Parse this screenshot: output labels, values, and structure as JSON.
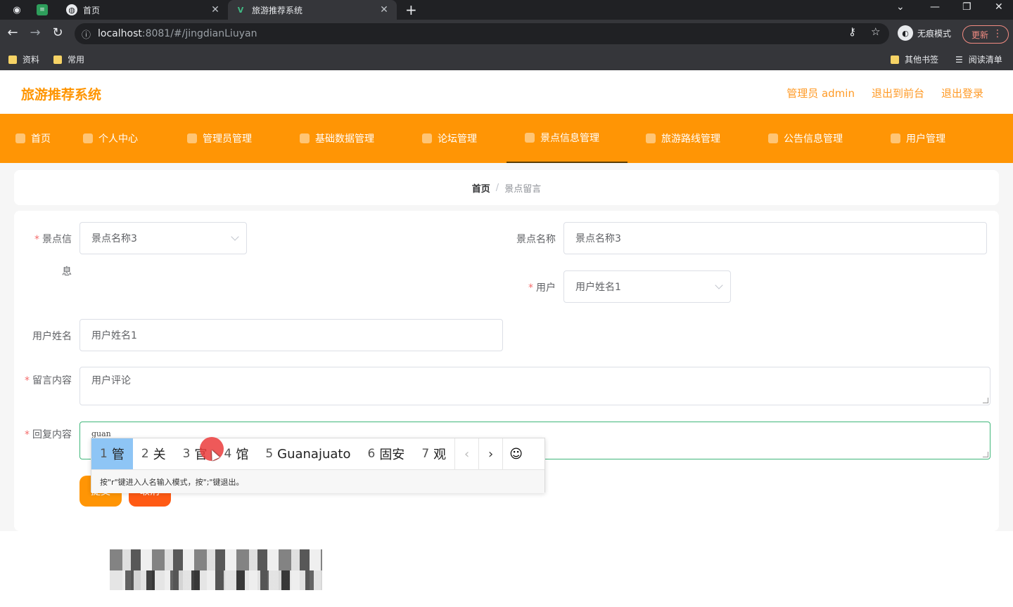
{
  "browser": {
    "tabs": [
      {
        "title": "首页",
        "active": false
      },
      {
        "title": "旅游推荐系统",
        "active": true
      }
    ],
    "url_host": "localhost",
    "url_path": ":8081/#/jingdianLiuyan",
    "incognito_label": "无痕模式",
    "update_label": "更新",
    "bookmarks": [
      "资料",
      "常用"
    ],
    "bookmarks_right": [
      "其他书签",
      "阅读清单"
    ]
  },
  "app": {
    "brand": "旅游推荐系统",
    "header_links": [
      "管理员 admin",
      "退出到前台",
      "退出登录"
    ],
    "nav": [
      {
        "label": "首页"
      },
      {
        "label": "个人中心"
      },
      {
        "label": "管理员管理"
      },
      {
        "label": "基础数据管理"
      },
      {
        "label": "论坛管理"
      },
      {
        "label": "景点信息管理",
        "active": true
      },
      {
        "label": "旅游路线管理"
      },
      {
        "label": "公告信息管理"
      },
      {
        "label": "用户管理"
      }
    ],
    "accent_color": "#ff9505"
  },
  "breadcrumb": {
    "home": "首页",
    "separator": "/",
    "current": "景点留言"
  },
  "form": {
    "jingdian_label_1": "景点信",
    "jingdian_label_2": "息",
    "jingdian_value": "景点名称3",
    "jingdian_name_label": "景点名称",
    "jingdian_name_value": "景点名称3",
    "user_label": "用户",
    "user_value": "用户姓名1",
    "username_label": "用户姓名",
    "username_value": "用户姓名1",
    "message_label": "留言内容",
    "message_value": "用户评论",
    "reply_label": "回复内容",
    "reply_value": "guan",
    "submit_label": "提交",
    "cancel_label": "取消"
  },
  "ime": {
    "candidates": [
      {
        "num": "1",
        "text": "管"
      },
      {
        "num": "2",
        "text": "关"
      },
      {
        "num": "3",
        "text": "官"
      },
      {
        "num": "4",
        "text": "馆"
      },
      {
        "num": "5",
        "text": "Guanajuato"
      },
      {
        "num": "6",
        "text": "固安"
      },
      {
        "num": "7",
        "text": "观"
      }
    ],
    "hint": "按\"r\"键进入人名输入模式，按\";\"键退出。"
  }
}
